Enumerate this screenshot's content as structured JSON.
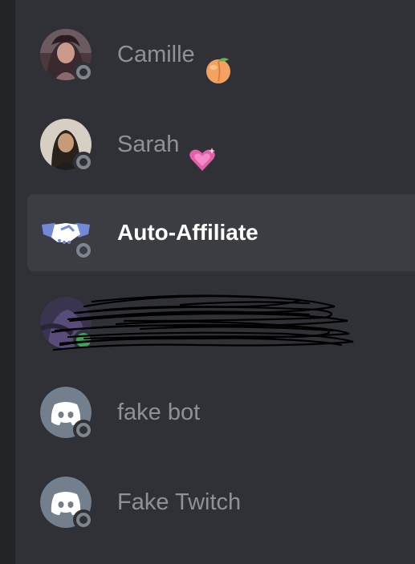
{
  "members": [
    {
      "name": "Camille",
      "status": "offline",
      "emoji": "peach"
    },
    {
      "name": "Sarah",
      "status": "offline",
      "emoji": "sparkling-heart"
    },
    {
      "name": "Auto-Affiliate",
      "status": "offline",
      "selected": true
    },
    {
      "name": "",
      "status": "online",
      "redacted": true
    },
    {
      "name": "fake bot",
      "status": "offline"
    },
    {
      "name": "Fake Twitch",
      "status": "offline"
    }
  ],
  "colors": {
    "background": "#2f3136",
    "rail": "#232428",
    "selected_row": "#3b3d43",
    "muted_text": "#8e9297",
    "offline": "#80848e",
    "online": "#3ba55c",
    "blurple_avatar": "#747f8d",
    "handshake": "#7289da"
  },
  "icons": [
    "peach-emoji",
    "sparkling-heart-emoji",
    "handshake-icon",
    "discord-logo-icon",
    "offline-status-icon",
    "online-status-icon"
  ]
}
